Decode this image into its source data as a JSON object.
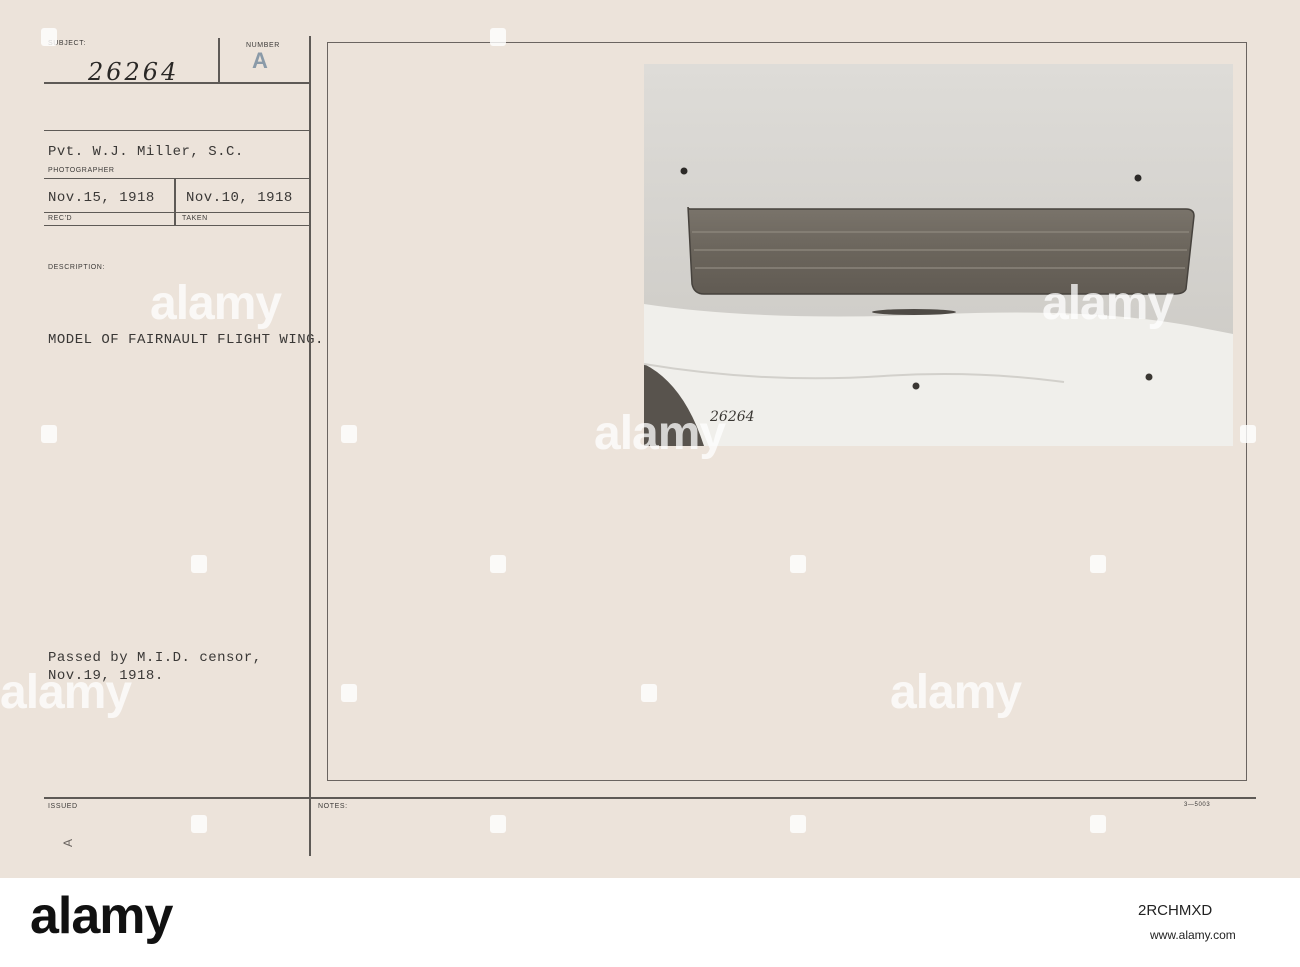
{
  "card": {
    "subject_label": "SUBJECT:",
    "subject_value": "26264",
    "number_label": "NUMBER",
    "number_value": "A",
    "photographer_name": "Pvt. W.J. Miller, S.C.",
    "photographer_label": "PHOTOGRAPHER",
    "received_date": "Nov.15, 1918",
    "received_label": "REC'D",
    "taken_date": "Nov.10, 1918",
    "taken_label": "TAKEN",
    "description_label": "DESCRIPTION:",
    "description": "MODEL OF FAIRNAULT FLIGHT WING.",
    "censor_line1": "Passed by M.I.D. censor,",
    "censor_line2": "Nov.19, 1918.",
    "issued_label": "ISSUED",
    "issued_mark": "A",
    "notes_label": "NOTES:",
    "form_number": "3—5003"
  },
  "photo": {
    "handwritten_number": "26264"
  },
  "watermark": {
    "text": "alamy",
    "footer_id": "2RCHMXD",
    "footer_site": "www.alamy.com"
  },
  "colors": {
    "card": "#ece3da",
    "ink": "#3a3836",
    "photo_wall": "#d6d4cf",
    "wing": "#6f6a62",
    "cloth": "#ecebe7"
  }
}
